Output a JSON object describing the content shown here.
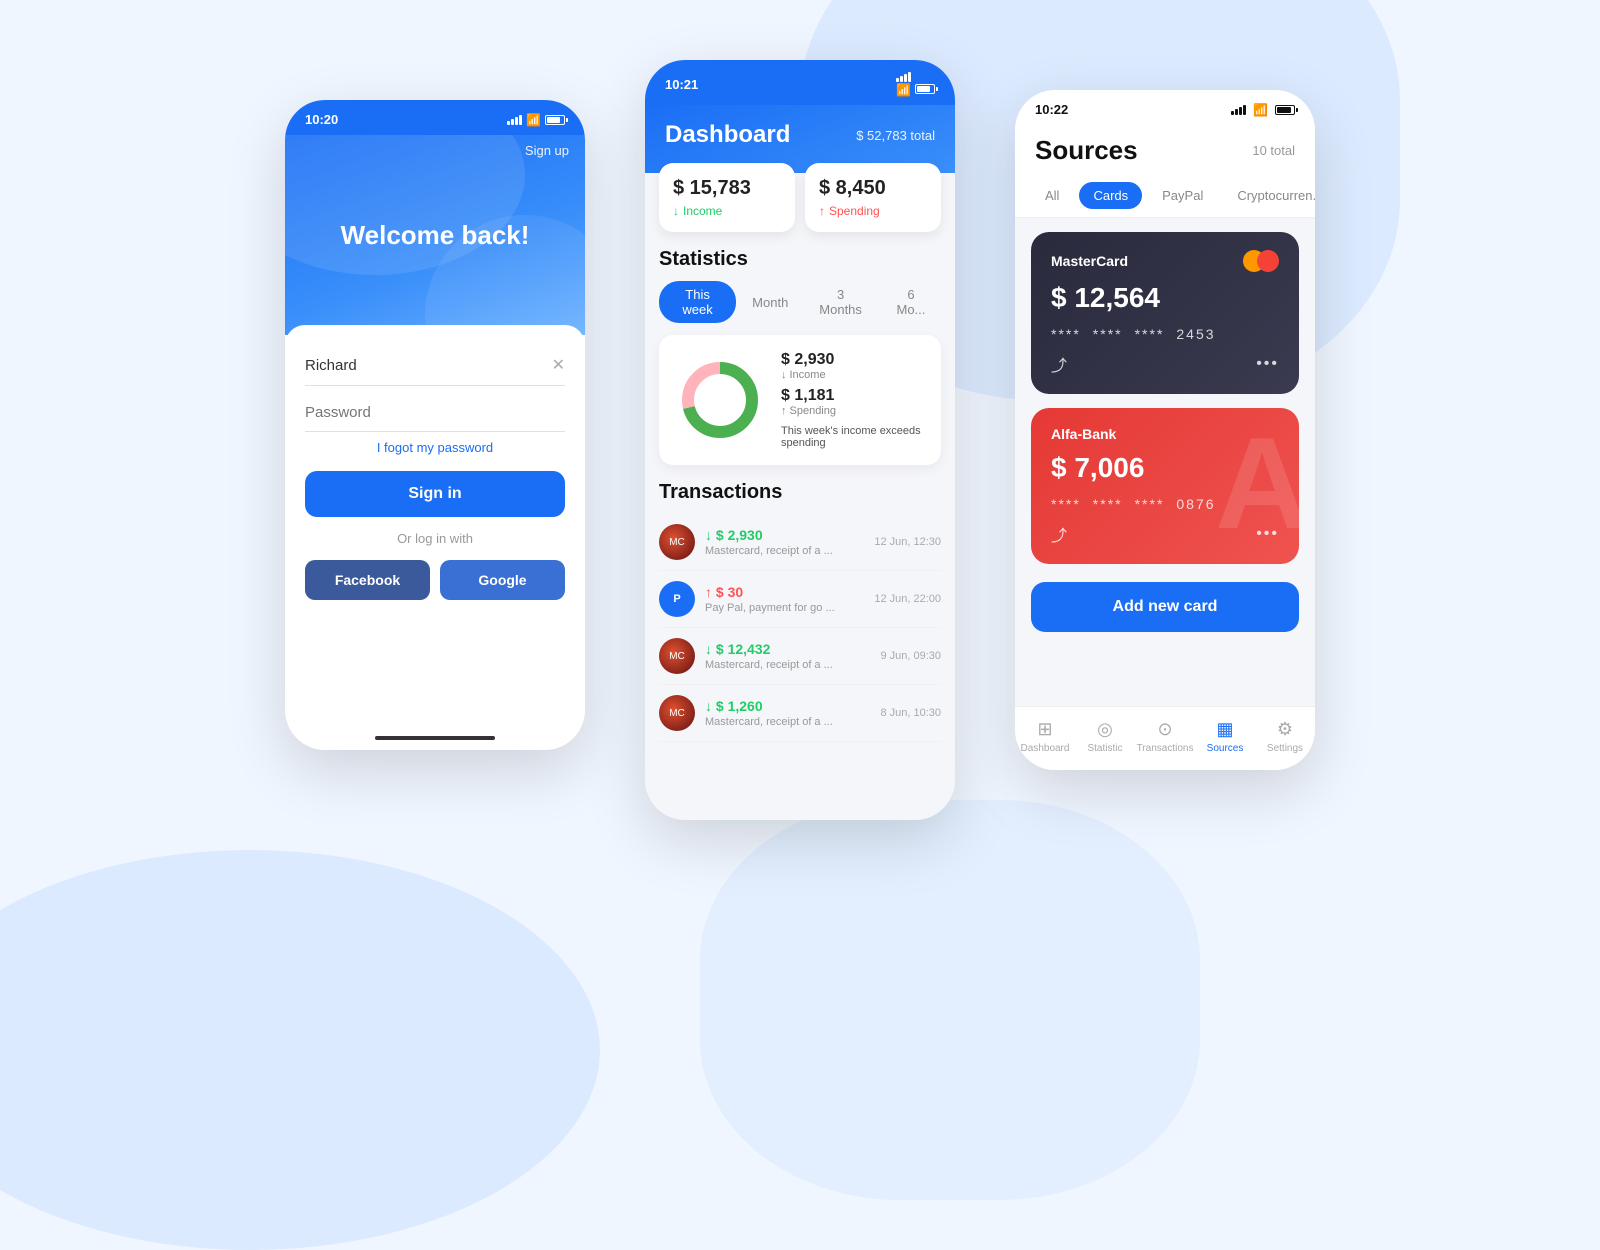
{
  "bg": {
    "color": "#f0f6ff"
  },
  "phone1": {
    "status_time": "10:20",
    "signup_label": "Sign up",
    "welcome_text": "Welcome back!",
    "username_placeholder": "Richard",
    "password_placeholder": "Password",
    "forgot_label": "I fogot my password",
    "signin_label": "Sign in",
    "or_label": "Or log in with",
    "facebook_label": "Facebook",
    "google_label": "Google"
  },
  "phone2": {
    "status_time": "10:21",
    "header_title": "Dashboard",
    "total_text": "$ 52,783 total",
    "income_amount": "$ 15,783",
    "income_label": "Income",
    "spending_amount": "$ 8,450",
    "spending_label": "Spending",
    "statistics_title": "Statistics",
    "tabs": [
      "This week",
      "Month",
      "3 Months",
      "6 Mo..."
    ],
    "active_tab": 0,
    "chart_income": "$ 2,930",
    "chart_income_label": "Income",
    "chart_spending": "$ 1,181",
    "chart_spending_label": "Spending",
    "chart_note": "This week's income exceeds spending",
    "transactions_title": "Transactions",
    "transactions": [
      {
        "amount": "↓ $ 2,930",
        "desc": "Mastercard, receipt of a ...",
        "date": "12 Jun, 12:30",
        "type": "down",
        "icon_color": "#c04020"
      },
      {
        "amount": "↑ $ 30",
        "desc": "Pay Pal, payment for go ...",
        "date": "12 Jun, 22:00",
        "type": "up",
        "icon_color": "#1a6ef5"
      },
      {
        "amount": "↓ $ 12,432",
        "desc": "Mastercard, receipt of a ...",
        "date": "9 Jun, 09:30",
        "type": "down",
        "icon_color": "#c04020"
      },
      {
        "amount": "↓ $ 1,260",
        "desc": "Mastercard, receipt of a ...",
        "date": "8 Jun, 10:30",
        "type": "down",
        "icon_color": "#c04020"
      }
    ]
  },
  "phone3": {
    "status_time": "10:22",
    "page_title": "Sources",
    "total_text": "10 total",
    "filter_tabs": [
      "All",
      "Cards",
      "PayPal",
      "Cryptocurren..."
    ],
    "active_filter": 1,
    "cards": [
      {
        "name": "MasterCard",
        "amount": "$ 12,564",
        "number": [
          "****",
          "****",
          "****",
          "2453"
        ],
        "type": "dark"
      },
      {
        "name": "Alfa-Bank",
        "amount": "$ 7,006",
        "number": [
          "****",
          "****",
          "****",
          "0876"
        ],
        "type": "red"
      }
    ],
    "add_card_label": "Add new card",
    "nav_items": [
      {
        "label": "Dashboard",
        "icon": "⊞",
        "active": false
      },
      {
        "label": "Statistic",
        "icon": "◎",
        "active": false
      },
      {
        "label": "Transactions",
        "icon": "⊙",
        "active": false
      },
      {
        "label": "Sources",
        "icon": "▦",
        "active": true
      },
      {
        "label": "Settings",
        "icon": "⚙",
        "active": false
      }
    ]
  }
}
